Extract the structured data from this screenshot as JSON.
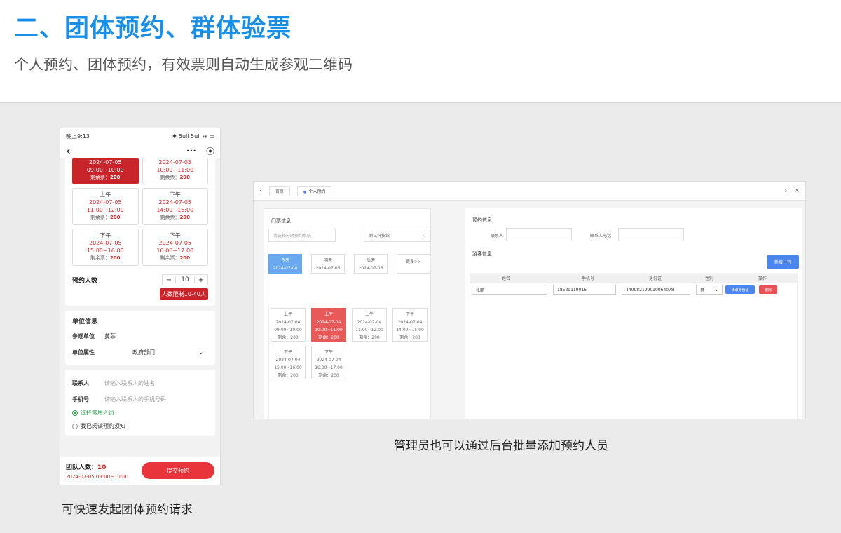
{
  "header": {
    "title": "二、团体预约、群体验票",
    "subtitle": "个人预约、团体预约，有效票则自动生成参观二维码"
  },
  "phone": {
    "status_time": "晚上9:13",
    "status_right": "✱ 5ull 5ull ≋ ▭",
    "nav_back": "‹",
    "nav_more": "•••",
    "nav_target": "⦿",
    "slots": [
      {
        "period": "",
        "date": "2024-07-05",
        "time": "09:00~10:00",
        "remain_label": "剩余票：",
        "remain": "200",
        "selected": true
      },
      {
        "period": "",
        "date": "2024-07-05",
        "time": "10:00~11:00",
        "remain_label": "剩余票：",
        "remain": "200",
        "selected": false
      },
      {
        "period": "上午",
        "date": "2024-07-05",
        "time": "11:00~12:00",
        "remain_label": "剩余票：",
        "remain": "200",
        "selected": false
      },
      {
        "period": "下午",
        "date": "2024-07-05",
        "time": "14:00~15:00",
        "remain_label": "剩余票：",
        "remain": "200",
        "selected": false
      },
      {
        "period": "下午",
        "date": "2024-07-05",
        "time": "15:00~16:00",
        "remain_label": "剩余票：",
        "remain": "200",
        "selected": false
      },
      {
        "period": "下午",
        "date": "2024-07-05",
        "time": "16:00~17:00",
        "remain_label": "剩余票：",
        "remain": "200",
        "selected": false
      }
    ],
    "count_label": "预约人数",
    "minus": "−",
    "count_value": "10",
    "plus": "+",
    "limit_note": "人数限制10-40人",
    "unit_title": "单位信息",
    "unit_name_label": "参观单位",
    "unit_name_value": "黄菲",
    "unit_type_label": "单位属性",
    "unit_type_value": "政府部门",
    "unit_type_arrow": "⌄",
    "contact_label": "联系人",
    "contact_placeholder": "请输入联系人的姓名",
    "phone_label": "手机号",
    "phone_placeholder": "请输入联系人的手机号码",
    "choose_common": "选择常用人员",
    "read_notice": "我已阅读预约须知",
    "team_count_label": "团队人数：",
    "team_count_value": "10",
    "selected_time": "2024-07-05 09:00~10:00",
    "submit": "提交预约"
  },
  "phone_caption": "可快速发起团体预约请求",
  "admin": {
    "tab_left_arrow": "‹",
    "tab_home": "首页",
    "tab_active": "个人预约",
    "tab_right_arrow": "›",
    "tab_close": "×",
    "ticket_title": "门票信息",
    "ticket_select_placeholder": "请选择分时预约系统",
    "museum_select": "测试科技馆",
    "select_arrow": "⌄",
    "days": [
      {
        "label": "今天",
        "date": "2024-07-04",
        "active": true
      },
      {
        "label": "明天",
        "date": "2024-07-05",
        "active": false
      },
      {
        "label": "后天",
        "date": "2024-07-06",
        "active": false
      },
      {
        "label": "更多>>",
        "date": "",
        "active": false
      }
    ],
    "slots": [
      {
        "period": "上午",
        "date": "2024-07-04",
        "time": "09:00~10:00",
        "remain": "剩余：200",
        "selected": false
      },
      {
        "period": "上午",
        "date": "2024-07-04",
        "time": "10:00~11:00",
        "remain": "剩余：200",
        "selected": true
      },
      {
        "period": "上午",
        "date": "2024-07-04",
        "time": "11:00~12:00",
        "remain": "剩余：200",
        "selected": false
      },
      {
        "period": "下午",
        "date": "2024-07-04",
        "time": "14:00~15:00",
        "remain": "剩余：200",
        "selected": false
      },
      {
        "period": "下午",
        "date": "2024-07-04",
        "time": "15:00~16:00",
        "remain": "剩余：200",
        "selected": false
      },
      {
        "period": "下午",
        "date": "2024-07-04",
        "time": "16:00~17:00",
        "remain": "剩余：200",
        "selected": false
      }
    ],
    "booking_title": "预约信息",
    "contact_label": "联系人",
    "contact_phone_label": "联系人电话",
    "visitor_title": "游客信息",
    "add_row": "新增一行",
    "columns": [
      "姓名",
      "手机号",
      "身份证",
      "性别",
      "操作"
    ],
    "row": {
      "name": "张丽",
      "phone": "18529119016",
      "id": "440982199010064078",
      "gender": "男",
      "gender_arrow": "⌄",
      "read_id": "读取身份证",
      "delete": "删除"
    }
  },
  "admin_caption": "管理员也可以通过后台批量添加预约人员",
  "colors": {
    "title": "#1b8fe6",
    "accent_red": "#c8242a",
    "admin_blue": "#4b86ec"
  }
}
